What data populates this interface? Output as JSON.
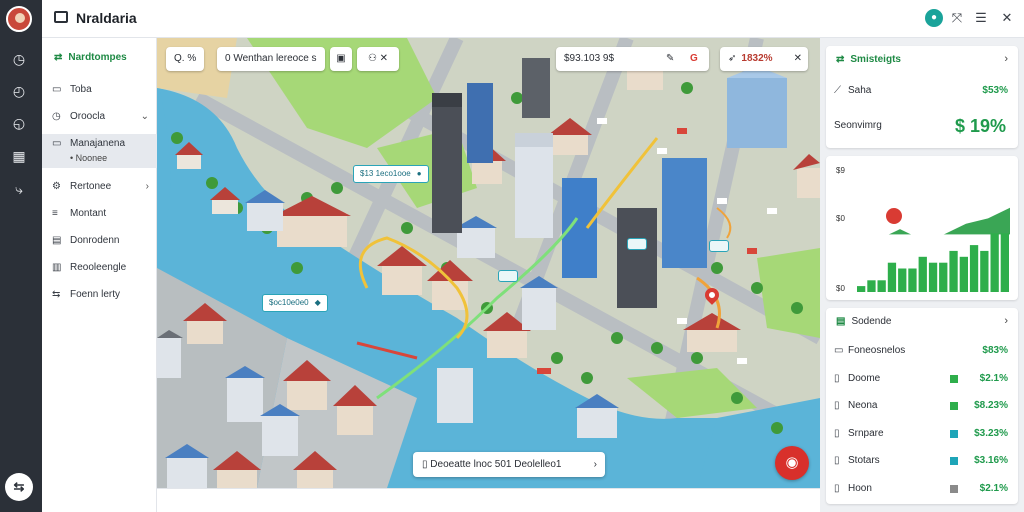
{
  "app": {
    "title": "Nraldaria"
  },
  "rail": {
    "icons": [
      "clock-icon",
      "history-icon",
      "timer-icon",
      "grid-icon",
      "route-icon"
    ],
    "fab_label": "⇆"
  },
  "sidebar": {
    "header": "Nardtompes",
    "items": [
      {
        "label": "Toba",
        "icon": "box-icon",
        "chevron": false
      },
      {
        "label": "Oroocla",
        "icon": "clock-icon",
        "chevron": true
      },
      {
        "label": "Manajanena",
        "sub": "Noonee",
        "icon": "chat-icon",
        "chevron": false,
        "active": true
      },
      {
        "label": "Rertonee",
        "icon": "gear-icon",
        "chevron": true
      },
      {
        "label": "Montant",
        "icon": "menu-icon",
        "chevron": false
      },
      {
        "label": "Donrodenn",
        "icon": "document-icon",
        "chevron": false
      },
      {
        "label": "Reooleengle",
        "icon": "chart-icon",
        "chevron": false
      },
      {
        "label": "Foenn lerty",
        "icon": "swap-icon",
        "chevron": false
      }
    ]
  },
  "map": {
    "search_chip": "Q. %",
    "location_chip": "0 Wenthan lereoce s",
    "price_chip": "$93.103 9$",
    "percent_chip": "1832%",
    "tags": [
      {
        "label": "$13 1eco1ooe"
      },
      {
        "label": "$oc10e0e0"
      }
    ],
    "bottom_pill": "Deoeatte lnoc 501 Deolelleo1",
    "water_color": "#5bb4d8",
    "park_color": "#a6d877",
    "route_color": "#f0c23a"
  },
  "stats": {
    "header": "Smisteigts",
    "rows": [
      {
        "label": "Saha",
        "value": "$53%"
      }
    ],
    "big_label": "Seonvimrg",
    "big_value": "$ 19%"
  },
  "chart_data": {
    "type": "bar",
    "title": "",
    "xlabel": "",
    "ylabel": "",
    "yticks": [
      "$9",
      "$0",
      "$0"
    ],
    "values": [
      1,
      2,
      2,
      5,
      4,
      4,
      6,
      5,
      5,
      7,
      6,
      8,
      7,
      10,
      10
    ],
    "ylim": [
      0,
      12
    ],
    "area": [
      4,
      5,
      7,
      5,
      6,
      8,
      9,
      11
    ],
    "bar_color": "#2eae4b",
    "area_color": "#3aa655",
    "marker_color": "#d93b33"
  },
  "summary": {
    "header": "Sodende",
    "rows": [
      {
        "label": "Foneosnelos",
        "value": "$83%",
        "swatch": ""
      },
      {
        "label": "Doome",
        "value": "$2.1%",
        "swatch": "#2eae4b"
      },
      {
        "label": "Neona",
        "value": "$8.23%",
        "swatch": "#2eae4b"
      },
      {
        "label": "Srnpare",
        "value": "$3.23%",
        "swatch": "#1ea5b8"
      },
      {
        "label": "Stotars",
        "value": "$3.16%",
        "swatch": "#1ea5b8"
      },
      {
        "label": "Hoon",
        "value": "$2.1%",
        "swatch": "#8a8a8a"
      }
    ]
  }
}
